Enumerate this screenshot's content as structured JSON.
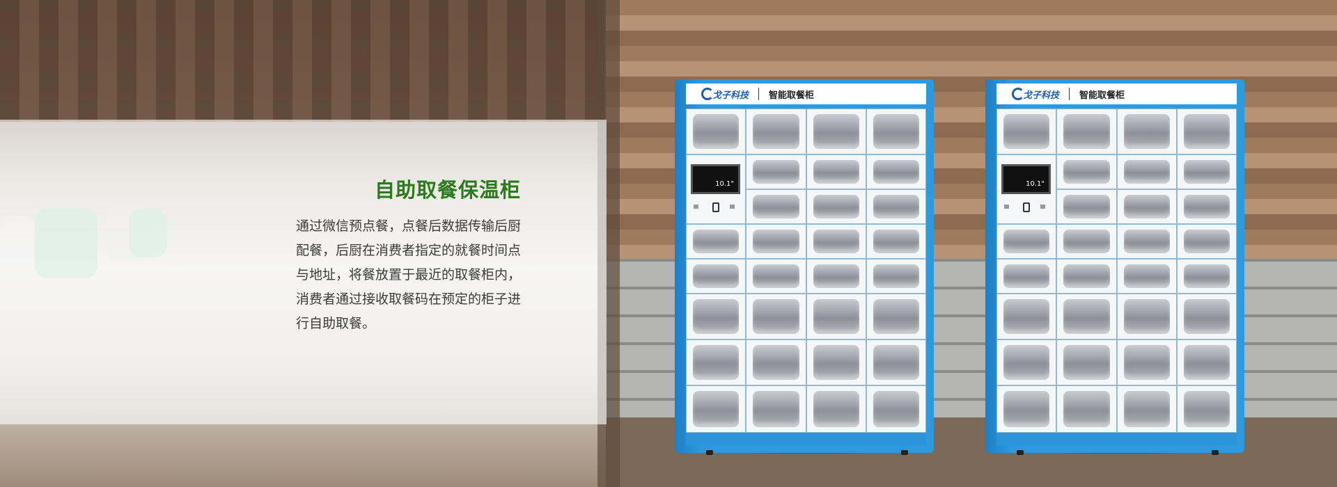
{
  "banner": {
    "title": "自助取餐保温柜",
    "description": "通过微信预点餐，点餐后数据传输后厨配餐，后厨在消费者指定的就餐时间点与地址，将餐放置于最近的取餐柜内， 消费者通过接收取餐码在预定的柜子进行自助取餐。"
  },
  "cabinets": [
    {
      "brand": "戈子科技",
      "product": "智能取餐柜",
      "screen_size": "10.1\""
    },
    {
      "brand": "戈子科技",
      "product": "智能取餐柜",
      "screen_size": "10.1\""
    }
  ],
  "colors": {
    "title_green": "#2b7a1e",
    "cabinet_blue": "#2e99dc"
  }
}
